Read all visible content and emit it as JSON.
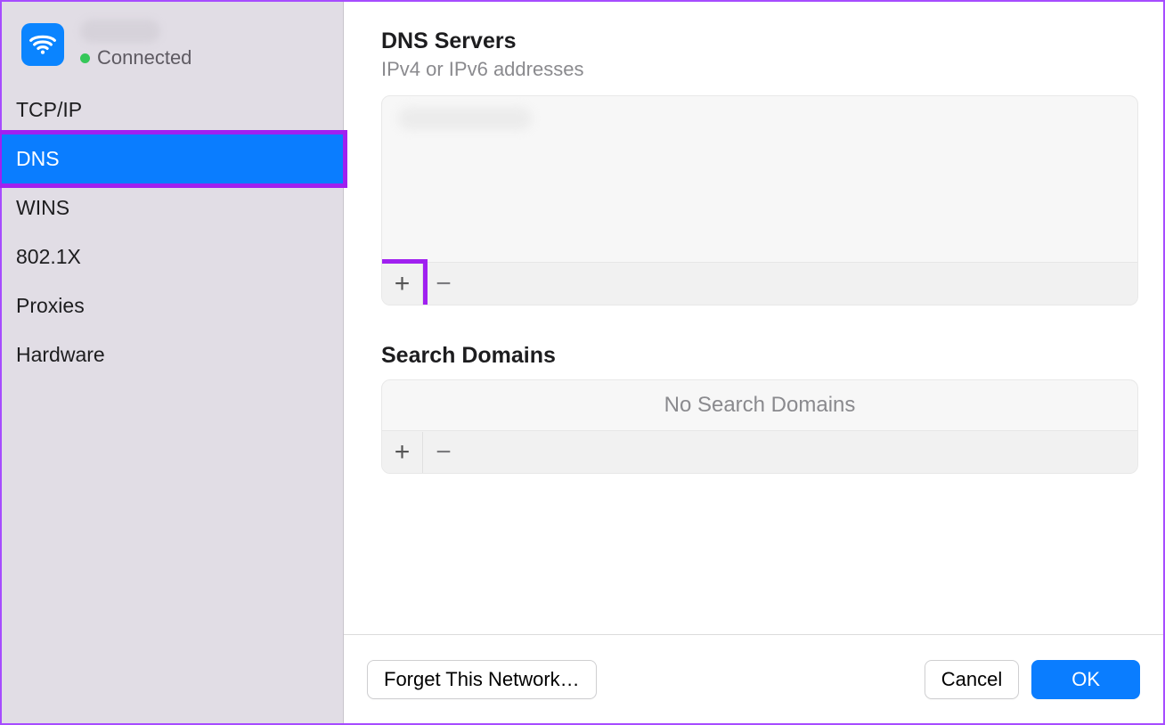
{
  "sidebar": {
    "connection_status": "Connected",
    "items": [
      {
        "label": "TCP/IP"
      },
      {
        "label": "DNS"
      },
      {
        "label": "WINS"
      },
      {
        "label": "802.1X"
      },
      {
        "label": "Proxies"
      },
      {
        "label": "Hardware"
      }
    ]
  },
  "dns": {
    "title": "DNS Servers",
    "subtitle": "IPv4 or IPv6 addresses",
    "add_symbol": "+",
    "remove_symbol": "−"
  },
  "search_domains": {
    "title": "Search Domains",
    "empty_text": "No Search Domains",
    "add_symbol": "+",
    "remove_symbol": "−"
  },
  "footer": {
    "forget_label": "Forget This Network…",
    "cancel_label": "Cancel",
    "ok_label": "OK"
  }
}
